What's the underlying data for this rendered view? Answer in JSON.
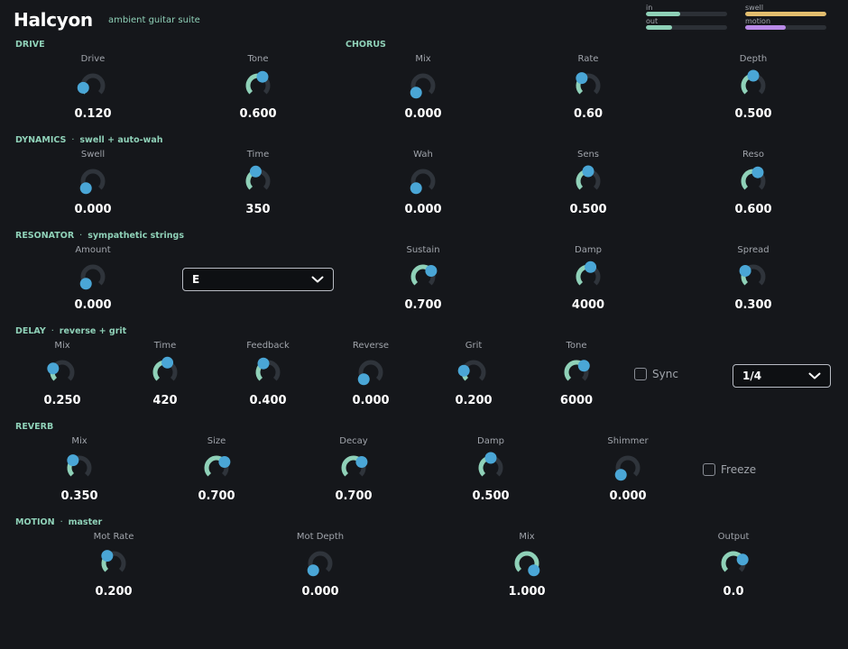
{
  "header": {
    "title": "Halcyon",
    "subtitle": "ambient guitar suite"
  },
  "meters": [
    {
      "label": "in",
      "level": 0.42,
      "color": "#8fd1b8"
    },
    {
      "label": "out",
      "level": 0.32,
      "color": "#8fd1b8"
    },
    {
      "label": "swell",
      "level": 1.0,
      "color": "#e2bd6e"
    },
    {
      "label": "motion",
      "level": 0.5,
      "color": "#b98ae8"
    }
  ],
  "colors": {
    "accent": "#8fd1b8",
    "knob_dot": "#4aa6d6",
    "knob_track": "#2f343b"
  },
  "sections": {
    "drive": {
      "name": "DRIVE"
    },
    "chorus": {
      "name": "CHORUS"
    },
    "dynamics": {
      "name": "DYNAMICS",
      "tag": "swell + auto-wah"
    },
    "resonator": {
      "name": "RESONATOR",
      "tag": "sympathetic strings"
    },
    "delay": {
      "name": "DELAY",
      "tag": "reverse + grit"
    },
    "reverb": {
      "name": "REVERB"
    },
    "motion": {
      "name": "MOTION",
      "tag": "master"
    }
  },
  "separator": "·",
  "knobs": [
    {
      "id": "drive-drive",
      "label": "Drive",
      "value": "0.120",
      "norm": 0.12
    },
    {
      "id": "drive-tone",
      "label": "Tone",
      "value": "0.600",
      "norm": 0.6
    },
    {
      "id": "chorus-mix",
      "label": "Mix",
      "value": "0.000",
      "norm": 0.0
    },
    {
      "id": "chorus-rate",
      "label": "Rate",
      "value": "0.60",
      "norm": 0.35
    },
    {
      "id": "chorus-depth",
      "label": "Depth",
      "value": "0.500",
      "norm": 0.5
    },
    {
      "id": "dyn-swell",
      "label": "Swell",
      "value": "0.000",
      "norm": 0.0
    },
    {
      "id": "dyn-time",
      "label": "Time",
      "value": "350",
      "norm": 0.45
    },
    {
      "id": "dyn-wah",
      "label": "Wah",
      "value": "0.000",
      "norm": 0.0
    },
    {
      "id": "dyn-sens",
      "label": "Sens",
      "value": "0.500",
      "norm": 0.5
    },
    {
      "id": "dyn-reso",
      "label": "Reso",
      "value": "0.600",
      "norm": 0.6
    },
    {
      "id": "res-amount",
      "label": "Amount",
      "value": "0.000",
      "norm": 0.0
    },
    {
      "id": "res-sustain",
      "label": "Sustain",
      "value": "0.700",
      "norm": 0.7
    },
    {
      "id": "res-damp",
      "label": "Damp",
      "value": "4000",
      "norm": 0.55
    },
    {
      "id": "res-spread",
      "label": "Spread",
      "value": "0.300",
      "norm": 0.3
    },
    {
      "id": "delay-mix",
      "label": "Mix",
      "value": "0.250",
      "norm": 0.25
    },
    {
      "id": "delay-time",
      "label": "Time",
      "value": "420",
      "norm": 0.55
    },
    {
      "id": "delay-feedback",
      "label": "Feedback",
      "value": "0.400",
      "norm": 0.4
    },
    {
      "id": "delay-reverse",
      "label": "Reverse",
      "value": "0.000",
      "norm": 0.0
    },
    {
      "id": "delay-grit",
      "label": "Grit",
      "value": "0.200",
      "norm": 0.2
    },
    {
      "id": "delay-tone",
      "label": "Tone",
      "value": "6000",
      "norm": 0.68
    },
    {
      "id": "rev-mix",
      "label": "Mix",
      "value": "0.350",
      "norm": 0.35
    },
    {
      "id": "rev-size",
      "label": "Size",
      "value": "0.700",
      "norm": 0.7
    },
    {
      "id": "rev-decay",
      "label": "Decay",
      "value": "0.700",
      "norm": 0.7
    },
    {
      "id": "rev-damp",
      "label": "Damp",
      "value": "0.500",
      "norm": 0.5
    },
    {
      "id": "rev-shimmer",
      "label": "Shimmer",
      "value": "0.000",
      "norm": 0.0
    },
    {
      "id": "mot-rate",
      "label": "Mot Rate",
      "value": "0.200",
      "norm": 0.35
    },
    {
      "id": "mot-depth",
      "label": "Mot Depth",
      "value": "0.000",
      "norm": 0.0
    },
    {
      "id": "mot-mix",
      "label": "Mix",
      "value": "1.000",
      "norm": 1.0
    },
    {
      "id": "mot-output",
      "label": "Output",
      "value": "0.0",
      "norm": 0.75
    }
  ],
  "resonator_key": {
    "selected": "E"
  },
  "delay_division": {
    "selected": "1/4"
  },
  "sync": {
    "label": "Sync",
    "checked": false
  },
  "freeze": {
    "label": "Freeze",
    "checked": false
  },
  "icons": {
    "dropdown": "chevron-down-icon",
    "checkbox": "checkbox-icon"
  }
}
